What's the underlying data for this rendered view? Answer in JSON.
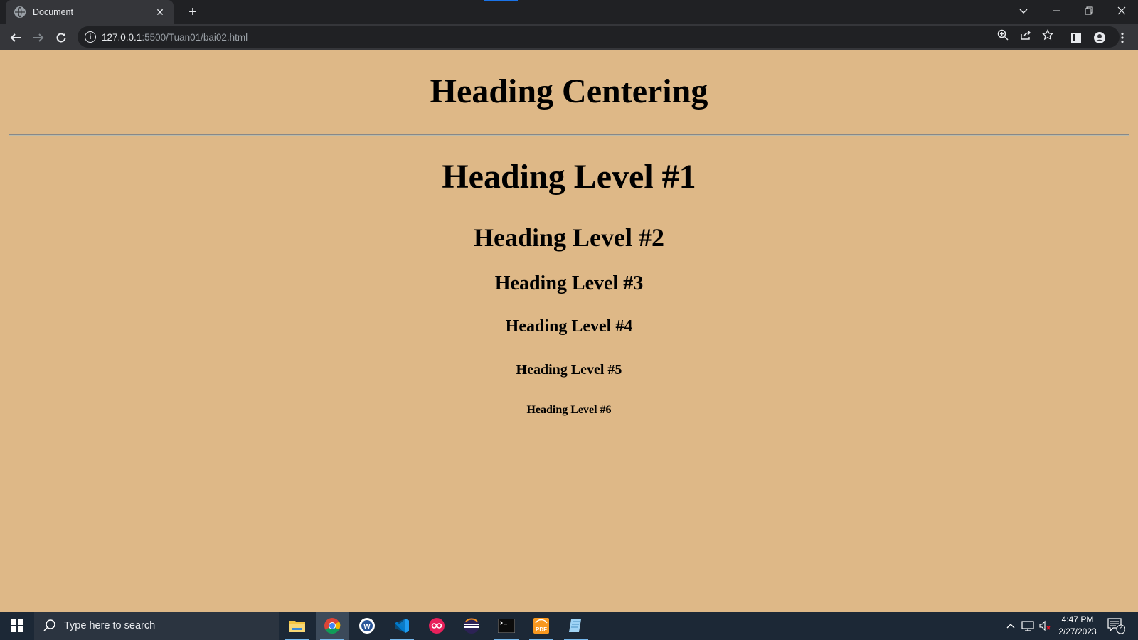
{
  "browser": {
    "tab_title": "Document",
    "new_tab_label": "+",
    "url_host": "127.0.0.1",
    "url_rest": ":5500/Tuan01/bai02.html"
  },
  "page": {
    "background": "#deb887",
    "heading_centering": "Heading Centering",
    "h1": "Heading Level #1",
    "h2": "Heading Level #2",
    "h3": "Heading Level #3",
    "h4": "Heading Level #4",
    "h5": "Heading Level #5",
    "h6": "Heading Level #6"
  },
  "taskbar": {
    "search_placeholder": "Type here to search",
    "time": "4:47 PM",
    "date": "2/27/2023",
    "notification_count": "2",
    "apps": [
      "file-explorer",
      "chrome",
      "word-app",
      "vscode",
      "app-red",
      "eclipse",
      "terminal",
      "pdf-app",
      "notepad-app"
    ]
  }
}
